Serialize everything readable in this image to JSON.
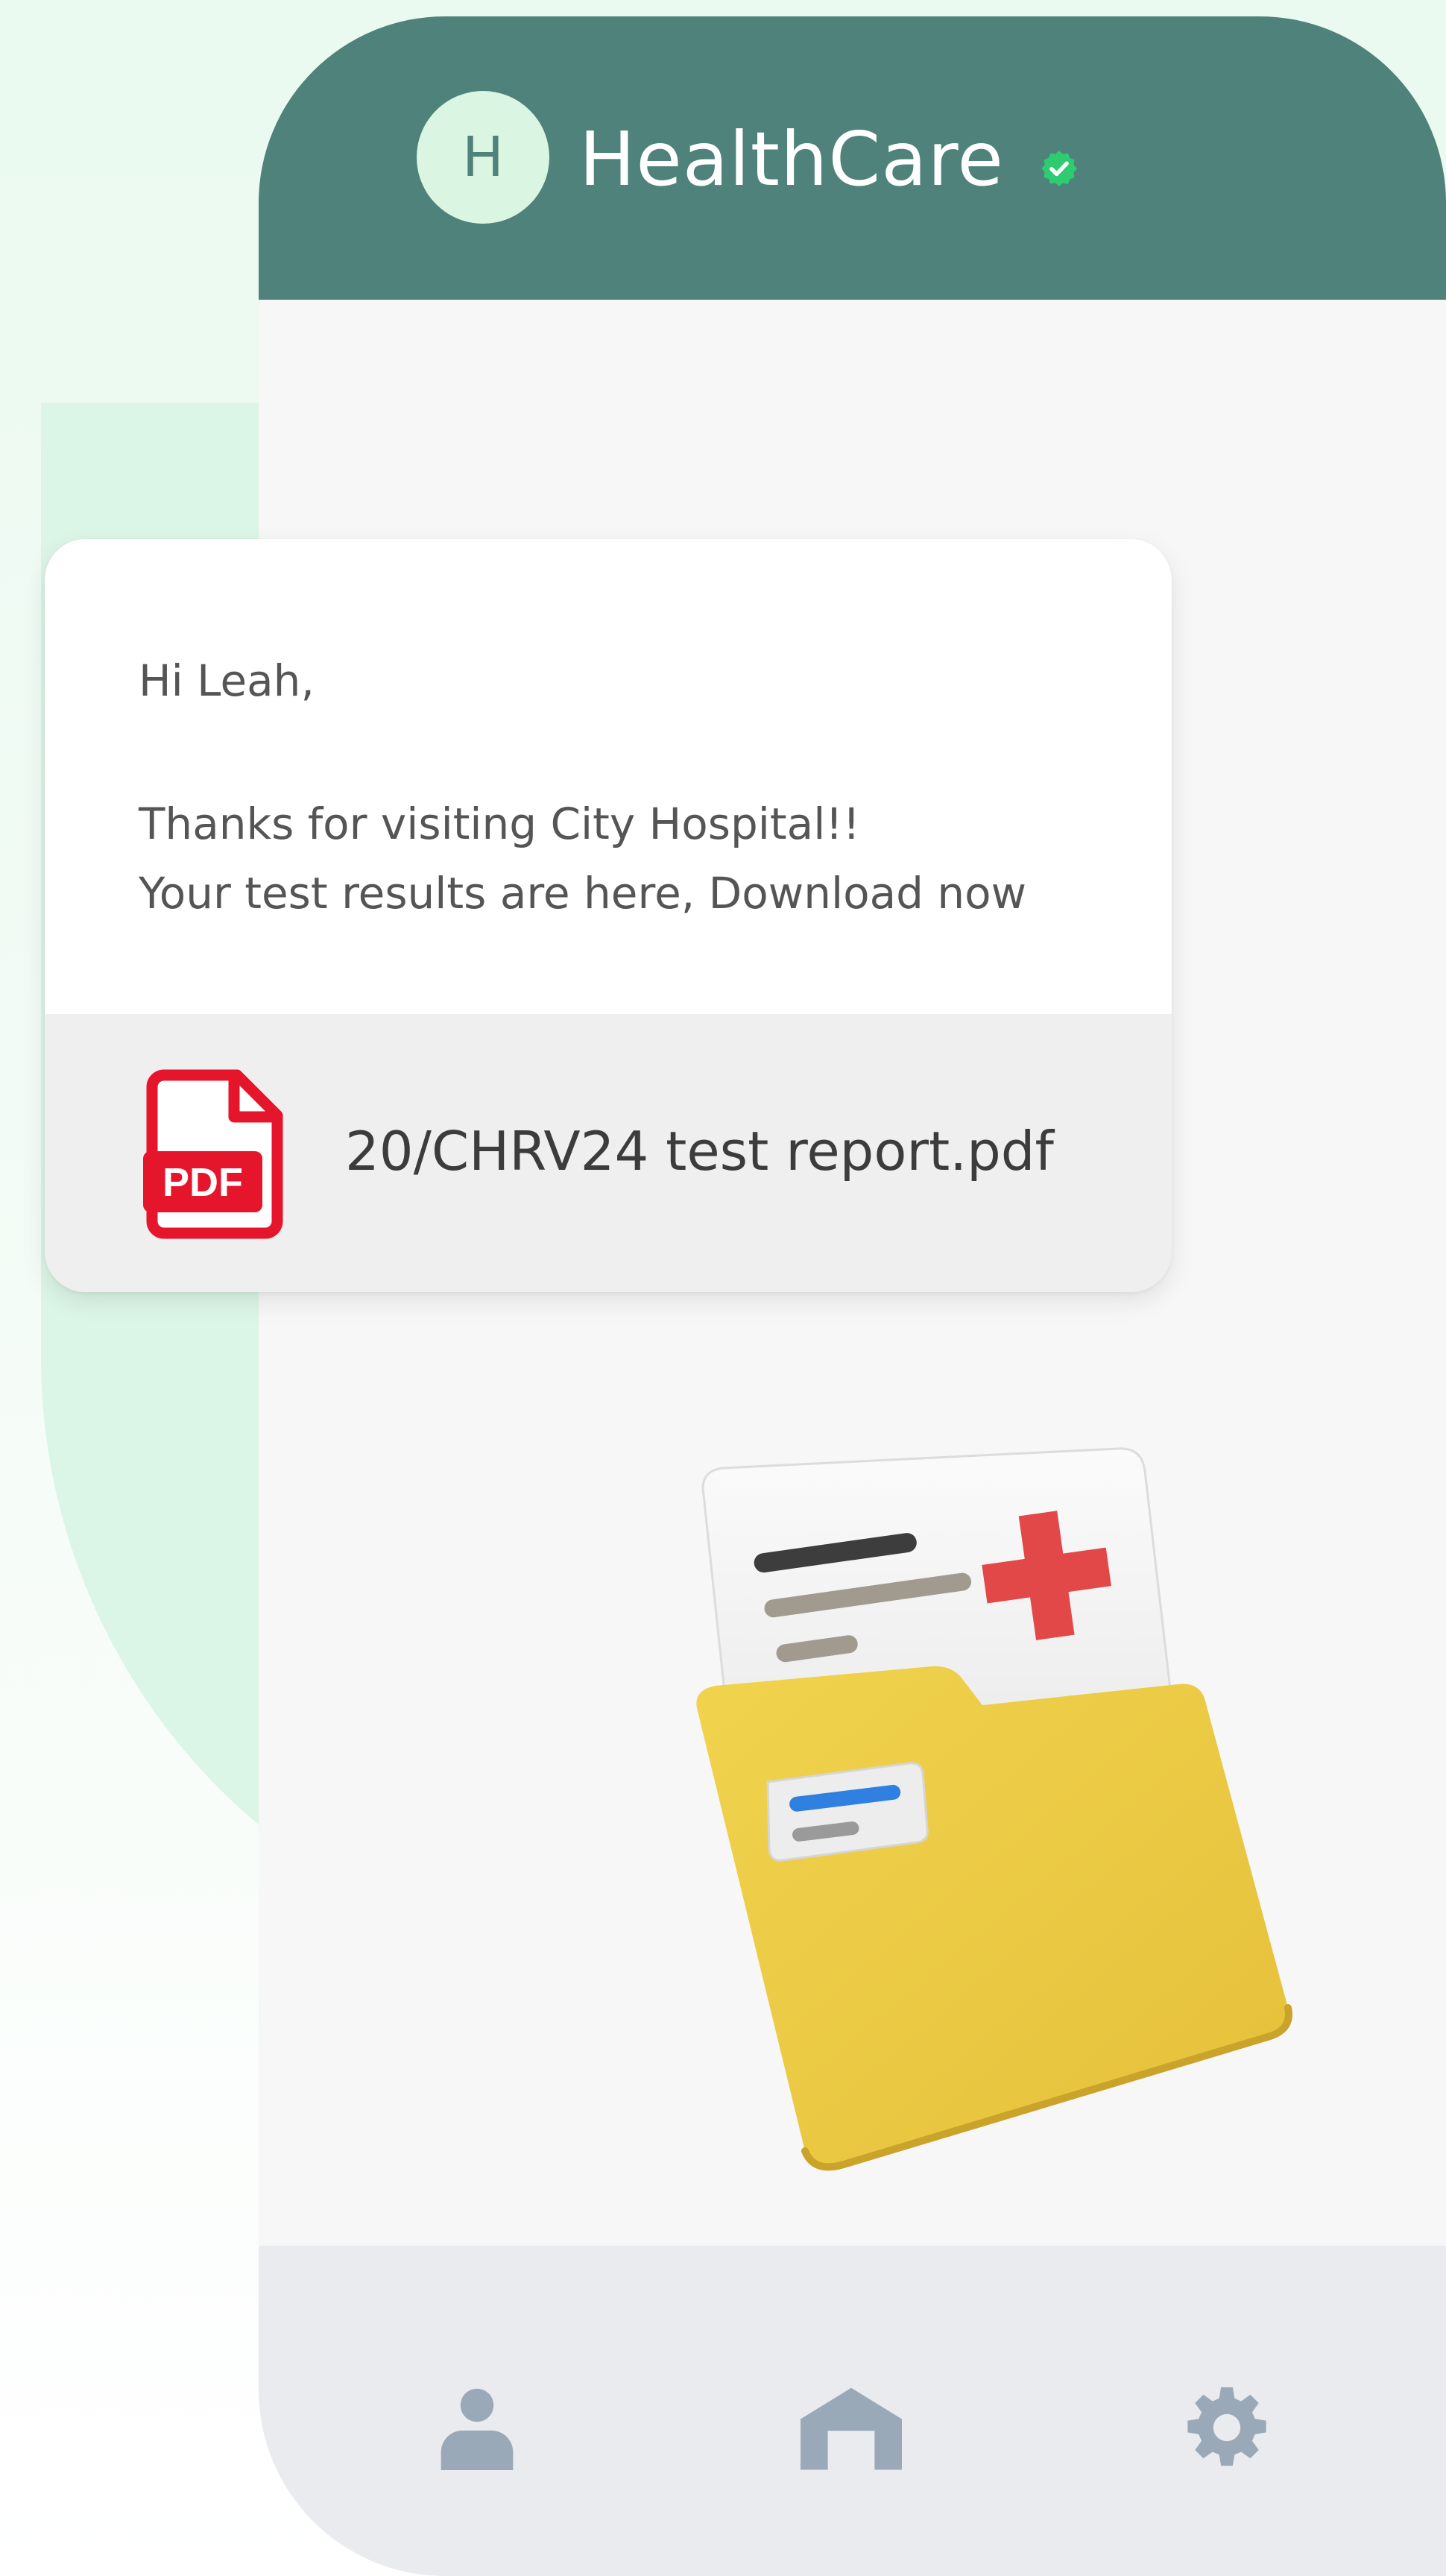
{
  "app": {
    "avatar_letter": "H",
    "title": "HealthCare",
    "verified_icon": "check-badge-icon",
    "header_color": "#4f827a",
    "verified_color": "#2ecc71"
  },
  "message": {
    "greeting": "Hi Leah,",
    "line1": "Thanks for visiting City Hospital!!",
    "line2": "Your test results are here, Download now",
    "attachment": {
      "icon": "pdf-file-icon",
      "badge": "PDF",
      "file_name": "20/CHRV24 test report.pdf",
      "icon_color": "#e5162b"
    }
  },
  "illustration": {
    "name": "medical-folder-illustration"
  },
  "bottom_nav": {
    "items": [
      {
        "icon": "profile-icon"
      },
      {
        "icon": "home-icon"
      },
      {
        "icon": "settings-icon"
      }
    ],
    "icon_color": "#9aa9b8"
  }
}
